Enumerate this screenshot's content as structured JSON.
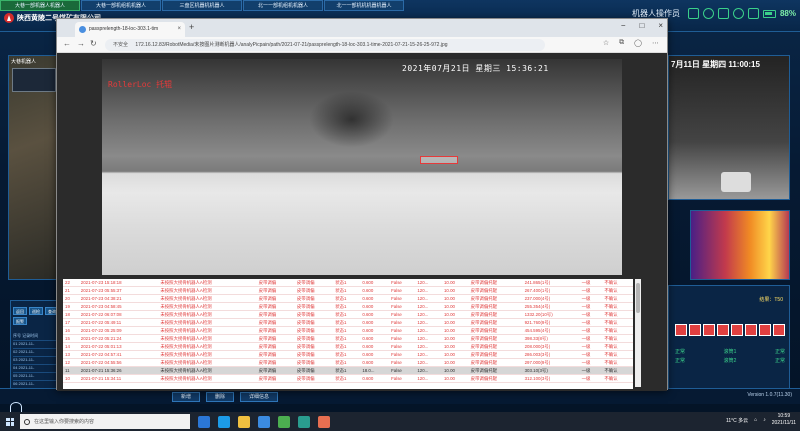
{
  "app": {
    "tabs": [
      "大巷一部机器人机器人",
      "大巷一部机组机机器人",
      "三盘区机器机机器人",
      "北一一部机组机机器人",
      "北一一部机机机器机器人"
    ],
    "company_name": "陕西黄陵二号煤矿有限公司",
    "operator": "机器人操作员",
    "battery": "88%"
  },
  "background": {
    "left_cam_label": "大巷机器人",
    "right_cam_date": "7月11日 星期四 11:00:15",
    "score_text": "结果：T50",
    "status_rows": [
      {
        "left": "正常",
        "mid": "滚筒1",
        "right": "正常"
      },
      {
        "left": "正常",
        "mid": "滚筒2",
        "right": "正常"
      }
    ],
    "left_buttons": [
      "返回",
      "巡检",
      "查询",
      "报警"
    ],
    "left_list": [
      "序号  记录时间",
      "01  2021-11-",
      "02  2021-11-",
      "03  2021-11-",
      "04  2021-11-",
      "05  2021-11-",
      "06  2021-11-"
    ],
    "bottom_buttons": [
      "新增",
      "删除",
      "详细信息"
    ],
    "version": "Version 1.0.7(11.30)"
  },
  "browser": {
    "tab_title": "passprelength-18-loc-303.1-tim",
    "url_insecure": "不安全",
    "url": "172.16.12.83/RobotMedia/未按图片测断机器人/analyPicpain/path/2021-07-21/passprelength-18-loc-303.1-time-2021-07-21-15-26-25-972.jpg"
  },
  "camera": {
    "datetime": "2021年07月21日 星期三 15:36:21",
    "label": "RollerLoc 托辊"
  },
  "log_table": {
    "rows": [
      [
        "22",
        "2021-07-23 15:18:18",
        "未按照大拐骨机器人A检测",
        "皮带调偏",
        "皮带调偏",
        "状态1",
        "0.600",
        "False",
        "120...",
        "10.00",
        "皮带调偏托辊",
        "241.865(1号)",
        "一级",
        "不确认"
      ],
      [
        "21",
        "2021-07-23 05:55:37",
        "未按照大拐骨机器人A检测",
        "皮带调偏",
        "皮带调偏",
        "状态1",
        "0.600",
        "False",
        "120...",
        "10.00",
        "皮带调偏托辊",
        "267.400(1号)",
        "一级",
        "不确认"
      ],
      [
        "20",
        "2021-07-23 04:38:21",
        "未按照大拐骨机器人A检测",
        "皮带调偏",
        "皮带调偏",
        "状态1",
        "0.600",
        "False",
        "120...",
        "10.00",
        "皮带调偏托辊",
        "237.000(4号)",
        "一级",
        "不确认"
      ],
      [
        "19",
        "2021-07-23 04:58:45",
        "未按照大拐骨机器人A检测",
        "皮带调偏",
        "皮带调偏",
        "状态1",
        "0.600",
        "False",
        "120...",
        "10.00",
        "皮带调偏托辊",
        "255.354(4号)",
        "一级",
        "不确认"
      ],
      [
        "18",
        "2021-07-22 06:07:08",
        "未按照大拐骨机器人A检测",
        "皮带调偏",
        "皮带调偏",
        "状态1",
        "0.600",
        "False",
        "120...",
        "10.00",
        "皮带调偏托辊",
        "1332.20(10号)",
        "一级",
        "不确认"
      ],
      [
        "17",
        "2021-07-22 05:49:11",
        "未按照大拐骨机器人A检测",
        "皮带调偏",
        "皮带调偏",
        "状态1",
        "0.600",
        "False",
        "120...",
        "10.00",
        "皮带调偏托辊",
        "921.760(9号)",
        "一级",
        "不确认"
      ],
      [
        "16",
        "2021-07-22 05:25:09",
        "未按照大拐骨机器人A检测",
        "皮带调偏",
        "皮带调偏",
        "状态1",
        "0.600",
        "False",
        "120...",
        "10.00",
        "皮带调偏托辊",
        "454.595(4号)",
        "一级",
        "不确认"
      ],
      [
        "15",
        "2021-07-22 05:21:24",
        "未按照大拐骨机器人A检测",
        "皮带调偏",
        "皮带调偏",
        "状态1",
        "0.600",
        "False",
        "120...",
        "10.00",
        "皮带调偏托辊",
        "398.33(8号)",
        "一级",
        "不确认"
      ],
      [
        "14",
        "2021-07-22 05:01:13",
        "未按照大拐骨机器人A检测",
        "皮带调偏",
        "皮带调偏",
        "状态1",
        "0.600",
        "False",
        "120...",
        "10.00",
        "皮带调偏托辊",
        "208.000(3号)",
        "一级",
        "不确认"
      ],
      [
        "13",
        "2021-07-22 04:57:41",
        "未按照大拐骨机器人A检测",
        "皮带调偏",
        "皮带调偏",
        "状态1",
        "0.600",
        "False",
        "120...",
        "10.00",
        "皮带调偏托辊",
        "286.003(3号)",
        "一级",
        "不确认"
      ],
      [
        "12",
        "2021-07-22 04:55:56",
        "未按照大拐骨机器人A检测",
        "皮带调偏",
        "皮带调偏",
        "状态1",
        "0.600",
        "False",
        "120...",
        "10.00",
        "皮带调偏托辊",
        "297.000(9号)",
        "一级",
        "不确认"
      ],
      [
        "11",
        "2021-07-21 15:36:26",
        "未按照大拐骨机器人A检测",
        "皮带调偏",
        "皮带调偏",
        "状态1",
        "18.0...",
        "False",
        "120...",
        "10.00",
        "皮带调偏托辊",
        "303.10(3号)",
        "一级",
        "不确认"
      ],
      [
        "10",
        "2021-07-21 15:34:11",
        "未按照大拐骨机器人A检测",
        "皮带调偏",
        "皮带调偏",
        "状态1",
        "0.600",
        "False",
        "120...",
        "10.00",
        "皮带调偏托辊",
        "312.100(3号)",
        "一级",
        "不确认"
      ]
    ],
    "selected_index": 11
  },
  "taskbar": {
    "search_placeholder": "在这里输入你要搜索的内容",
    "weather": "11°C 多云",
    "time": "10:59",
    "date": "2021/11/11"
  },
  "colors": {
    "alert_red": "#e03b3b",
    "panel_blue": "#0b2a4f",
    "accent_green": "#3ad08a"
  }
}
